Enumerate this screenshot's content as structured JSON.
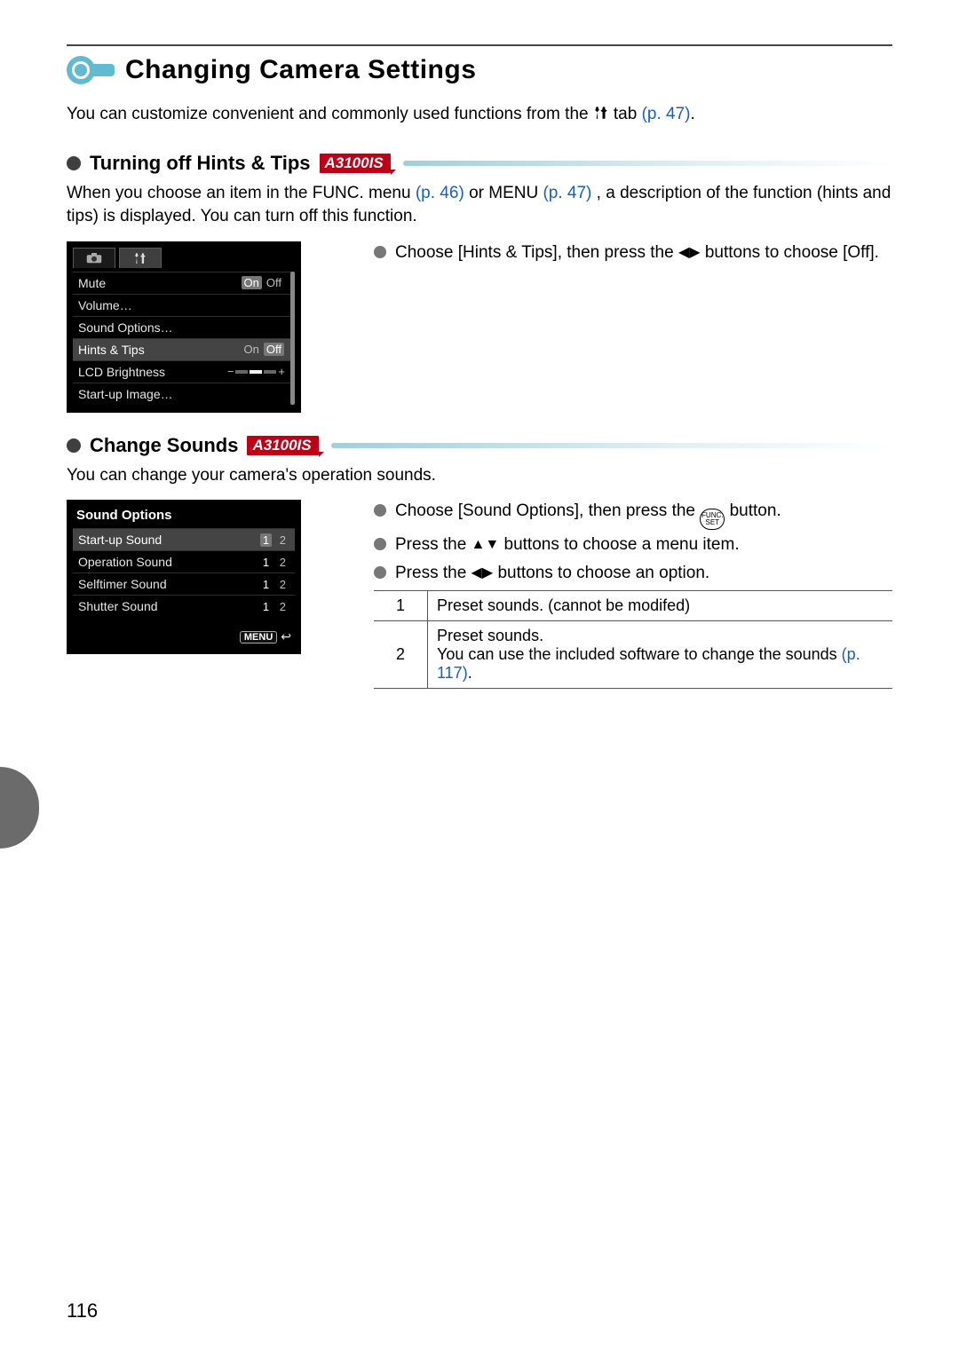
{
  "page": {
    "title": "Changing Camera Settings",
    "intro_part1": "You can customize convenient and commonly used functions from the ",
    "intro_part2": " tab ",
    "intro_ref": "(p. 47)",
    "intro_end": ".",
    "page_number": "116"
  },
  "section_hints": {
    "title": "Turning off Hints & Tips",
    "badge": "A3100IS",
    "body_a": "When you choose an item in the FUNC. menu ",
    "body_ref1": "(p. 46)",
    "body_b": " or MENU ",
    "body_ref2": "(p. 47)",
    "body_c": ", a description of the function (hints and tips) is displayed. You can turn off this function.",
    "instr_a": "Choose [Hints & Tips], then press the ",
    "instr_b": " buttons to choose [Off].",
    "cam": {
      "rows": [
        {
          "label": "Mute",
          "on": "On",
          "off": "Off",
          "sel": "On"
        },
        {
          "label": "Volume…"
        },
        {
          "label": "Sound Options…"
        },
        {
          "label": "Hints & Tips",
          "on": "On",
          "off": "Off",
          "sel": "Off",
          "highlight": true
        },
        {
          "label": "LCD Brightness",
          "slider": true,
          "minus": "−",
          "plus": "+"
        },
        {
          "label": "Start-up Image…"
        }
      ]
    }
  },
  "section_sounds": {
    "title": "Change Sounds",
    "badge": "A3100IS",
    "intro": "You can change your camera's operation sounds.",
    "cam": {
      "title": "Sound Options",
      "rows": [
        {
          "label": "Start-up Sound",
          "one": "1",
          "two": "2",
          "sel": "1",
          "highlight": true
        },
        {
          "label": "Operation Sound",
          "one": "1",
          "two": "2",
          "sel": "1"
        },
        {
          "label": "Selftimer Sound",
          "one": "1",
          "two": "2",
          "sel": "1"
        },
        {
          "label": "Shutter Sound",
          "one": "1",
          "two": "2",
          "sel": "1"
        }
      ],
      "menu_label": "MENU"
    },
    "instr": [
      {
        "a": "Choose [Sound Options], then press the ",
        "icon": "funcset",
        "b": " button."
      },
      {
        "a": "Press the ",
        "icon": "updown",
        "b": " buttons to choose a menu item."
      },
      {
        "a": "Press the ",
        "icon": "leftright",
        "b": " buttons to choose an option."
      }
    ],
    "table": [
      {
        "n": "1",
        "text_a": "Preset sounds. (cannot be modifed)"
      },
      {
        "n": "2",
        "text_a": "Preset sounds.",
        "text_b": "You can use the included software to change the sounds ",
        "ref": "(p. 117)",
        "text_c": "."
      }
    ]
  }
}
